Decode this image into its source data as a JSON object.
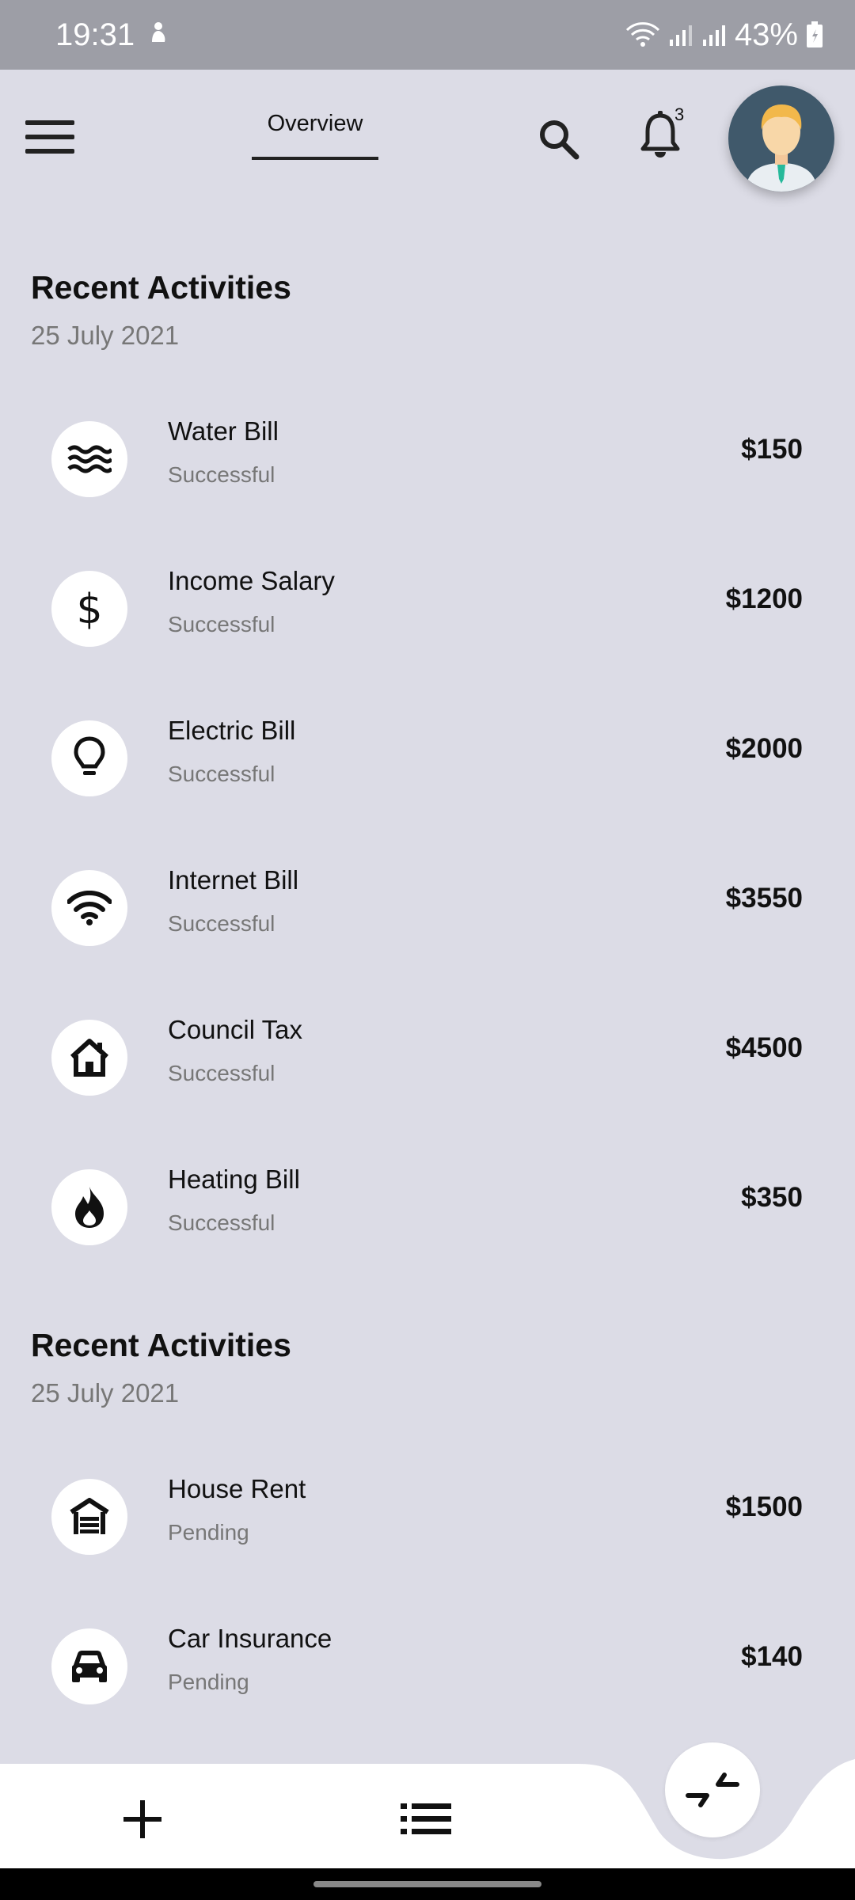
{
  "status_bar": {
    "time": "19:31",
    "battery": "43%"
  },
  "header": {
    "tab_label": "Overview",
    "notification_count": "3",
    "icons": [
      "menu-icon",
      "search-icon",
      "bell-icon",
      "avatar"
    ]
  },
  "sections": [
    {
      "title": "Recent Activities",
      "date": "25 July 2021",
      "items": [
        {
          "icon": "water-waves-icon",
          "title": "Water Bill",
          "status": "Successful",
          "amount": "$150"
        },
        {
          "icon": "dollar-icon",
          "title": "Income Salary",
          "status": "Successful",
          "amount": "$1200"
        },
        {
          "icon": "lightbulb-icon",
          "title": "Electric Bill",
          "status": "Successful",
          "amount": "$2000"
        },
        {
          "icon": "wifi-icon",
          "title": "Internet Bill",
          "status": "Successful",
          "amount": "$3550"
        },
        {
          "icon": "house-icon",
          "title": "Council Tax",
          "status": "Successful",
          "amount": "$4500"
        },
        {
          "icon": "flame-icon",
          "title": "Heating Bill",
          "status": "Successful",
          "amount": "$350"
        }
      ]
    },
    {
      "title": "Recent Activities",
      "date": "25 July 2021",
      "items": [
        {
          "icon": "garage-icon",
          "title": "House Rent",
          "status": "Pending",
          "amount": "$1500"
        },
        {
          "icon": "car-icon",
          "title": "Car Insurance",
          "status": "Pending",
          "amount": "$140"
        }
      ]
    }
  ],
  "bottom_nav": {
    "icons": [
      "plus-icon",
      "list-icon",
      "compress-arrows-icon"
    ]
  },
  "colors": {
    "background": "#dcdce6",
    "status_bar": "#9d9ea6",
    "surface": "#ffffff",
    "muted_text": "#777777",
    "avatar_bg": "#40596b"
  }
}
